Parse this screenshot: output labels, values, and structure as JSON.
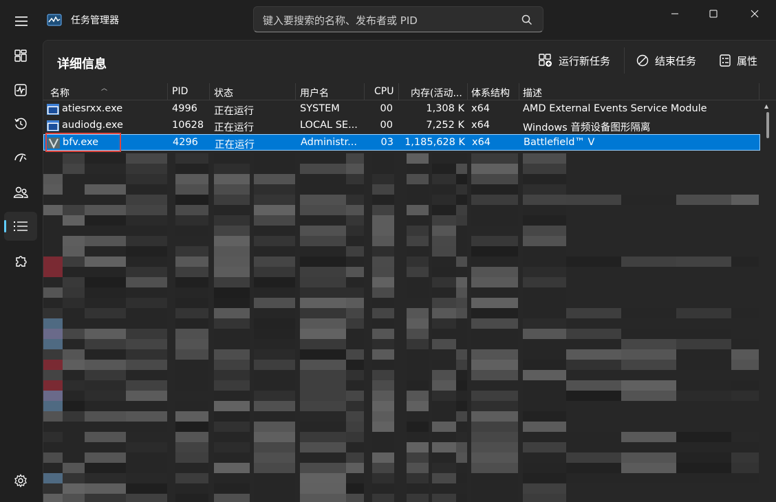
{
  "app": {
    "title": "任务管理器",
    "search_placeholder": "键入要搜索的名称、发布者或 PID"
  },
  "nav": {
    "items": [
      {
        "name": "processes",
        "icon": "grid-icon"
      },
      {
        "name": "performance",
        "icon": "pulse-icon"
      },
      {
        "name": "app-history",
        "icon": "history-icon"
      },
      {
        "name": "startup-apps",
        "icon": "speedometer-icon"
      },
      {
        "name": "users",
        "icon": "users-icon"
      },
      {
        "name": "details",
        "icon": "list-icon",
        "active": true
      },
      {
        "name": "services",
        "icon": "puzzle-icon"
      }
    ],
    "settings_icon": "gear-icon"
  },
  "page": {
    "title": "详细信息",
    "commands": {
      "run_new_task": "运行新任务",
      "end_task": "结束任务",
      "properties": "属性"
    }
  },
  "table": {
    "columns": [
      "名称",
      "PID",
      "状态",
      "用户名",
      "CPU",
      "内存(活动...",
      "体系结构",
      "描述"
    ],
    "rows": [
      {
        "name": "atiesrxx.exe",
        "pid": "4996",
        "status": "正在运行",
        "user": "SYSTEM",
        "cpu": "00",
        "mem": "1,308 K",
        "arch": "x64",
        "desc": "AMD External Events Service Module",
        "icon": "window-app-icon"
      },
      {
        "name": "audiodg.exe",
        "pid": "10628",
        "status": "正在运行",
        "user": "LOCAL SE...",
        "cpu": "00",
        "mem": "7,252 K",
        "arch": "x64",
        "desc": "Windows 音频设备图形隔离",
        "icon": "window-app-icon"
      },
      {
        "name": "bfv.exe",
        "pid": "4296",
        "status": "正在运行",
        "user": "Administr...",
        "cpu": "03",
        "mem": "1,185,628 K",
        "arch": "x64",
        "desc": "Battlefield™ V",
        "icon": "battlefield-v-icon",
        "selected": true
      }
    ]
  },
  "colors": {
    "background": "#202020",
    "panel": "#272727",
    "selection": "#0078d4",
    "highlight_box": "#e0463e",
    "accent": "#60cdff"
  }
}
